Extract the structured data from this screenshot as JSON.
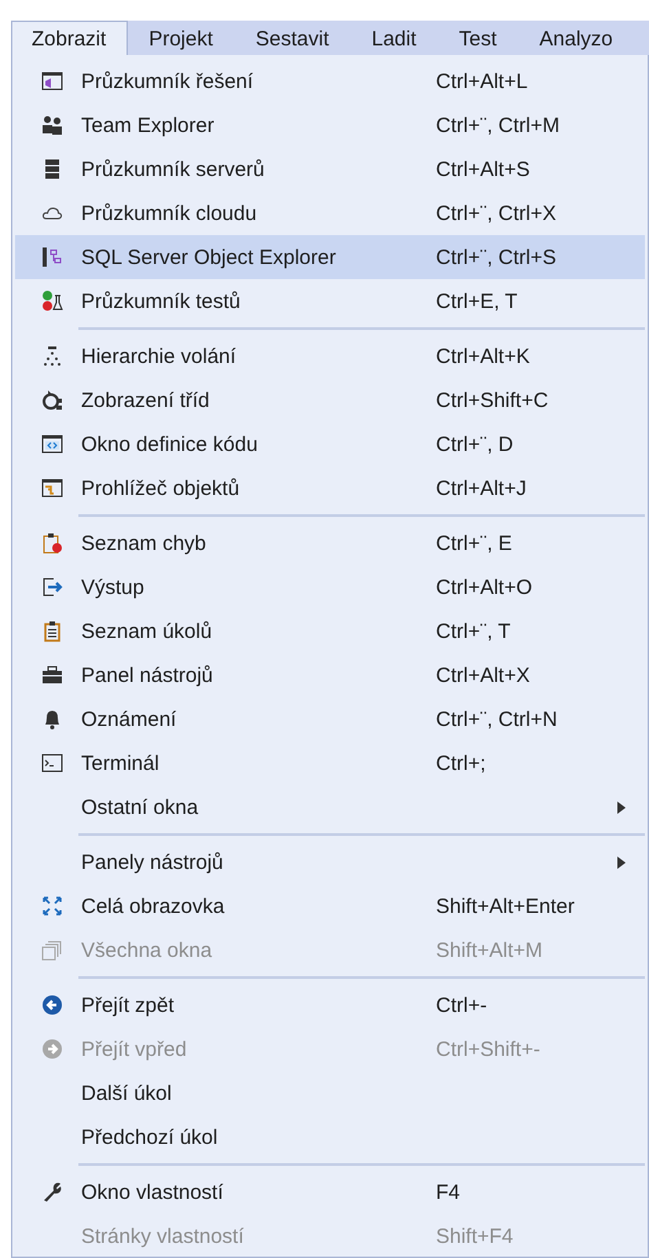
{
  "menubar": [
    {
      "label": "Zobrazit",
      "selected": true
    },
    {
      "label": "Projekt",
      "selected": false
    },
    {
      "label": "Sestavit",
      "selected": false
    },
    {
      "label": "Ladit",
      "selected": false
    },
    {
      "label": "Test",
      "selected": false
    },
    {
      "label": "Analyzo",
      "selected": false
    }
  ],
  "menu": {
    "groups": [
      [
        {
          "label": "Průzkumník řešení",
          "shortcut": "Ctrl+Alt+L",
          "disabled": false,
          "selected": false
        },
        {
          "label": "Team Explorer",
          "shortcut": "Ctrl+¨, Ctrl+M",
          "disabled": false,
          "selected": false
        },
        {
          "label": "Průzkumník serverů",
          "shortcut": "Ctrl+Alt+S",
          "disabled": false,
          "selected": false
        },
        {
          "label": "Průzkumník cloudu",
          "shortcut": "Ctrl+¨, Ctrl+X",
          "disabled": false,
          "selected": false
        },
        {
          "label": "SQL Server Object Explorer",
          "shortcut": "Ctrl+¨, Ctrl+S",
          "disabled": false,
          "selected": true
        },
        {
          "label": "Průzkumník testů",
          "shortcut": "Ctrl+E, T",
          "disabled": false,
          "selected": false
        }
      ],
      [
        {
          "label": "Hierarchie volání",
          "shortcut": "Ctrl+Alt+K",
          "disabled": false,
          "selected": false
        },
        {
          "label": "Zobrazení tříd",
          "shortcut": "Ctrl+Shift+C",
          "disabled": false,
          "selected": false
        },
        {
          "label": "Okno definice kódu",
          "shortcut": "Ctrl+¨, D",
          "disabled": false,
          "selected": false
        },
        {
          "label": "Prohlížeč objektů",
          "shortcut": "Ctrl+Alt+J",
          "disabled": false,
          "selected": false
        }
      ],
      [
        {
          "label": "Seznam chyb",
          "shortcut": "Ctrl+¨, E",
          "disabled": false,
          "selected": false
        },
        {
          "label": "Výstup",
          "shortcut": "Ctrl+Alt+O",
          "disabled": false,
          "selected": false
        },
        {
          "label": "Seznam úkolů",
          "shortcut": "Ctrl+¨, T",
          "disabled": false,
          "selected": false
        },
        {
          "label": "Panel nástrojů",
          "shortcut": "Ctrl+Alt+X",
          "disabled": false,
          "selected": false
        },
        {
          "label": "Oznámení",
          "shortcut": "Ctrl+¨, Ctrl+N",
          "disabled": false,
          "selected": false
        },
        {
          "label": "Terminál",
          "shortcut": "Ctrl+;",
          "disabled": false,
          "selected": false
        },
        {
          "label": "Ostatní okna",
          "submenu": true,
          "disabled": false,
          "selected": false
        }
      ],
      [
        {
          "label": "Panely nástrojů",
          "submenu": true,
          "disabled": false,
          "selected": false
        },
        {
          "label": "Celá obrazovka",
          "shortcut": "Shift+Alt+Enter",
          "disabled": false,
          "selected": false
        },
        {
          "label": "Všechna okna",
          "shortcut": "Shift+Alt+M",
          "disabled": true,
          "selected": false
        }
      ],
      [
        {
          "label": "Přejít zpět",
          "shortcut": "Ctrl+-",
          "disabled": false,
          "selected": false
        },
        {
          "label": "Přejít vpřed",
          "shortcut": "Ctrl+Shift+-",
          "disabled": true,
          "selected": false
        },
        {
          "label": "Další úkol",
          "disabled": false,
          "selected": false
        },
        {
          "label": "Předchozí úkol",
          "disabled": false,
          "selected": false
        }
      ],
      [
        {
          "label": "Okno vlastností",
          "shortcut": "F4",
          "disabled": false,
          "selected": false
        },
        {
          "label": "Stránky vlastností",
          "shortcut": "Shift+F4",
          "disabled": true,
          "selected": false
        }
      ]
    ]
  }
}
